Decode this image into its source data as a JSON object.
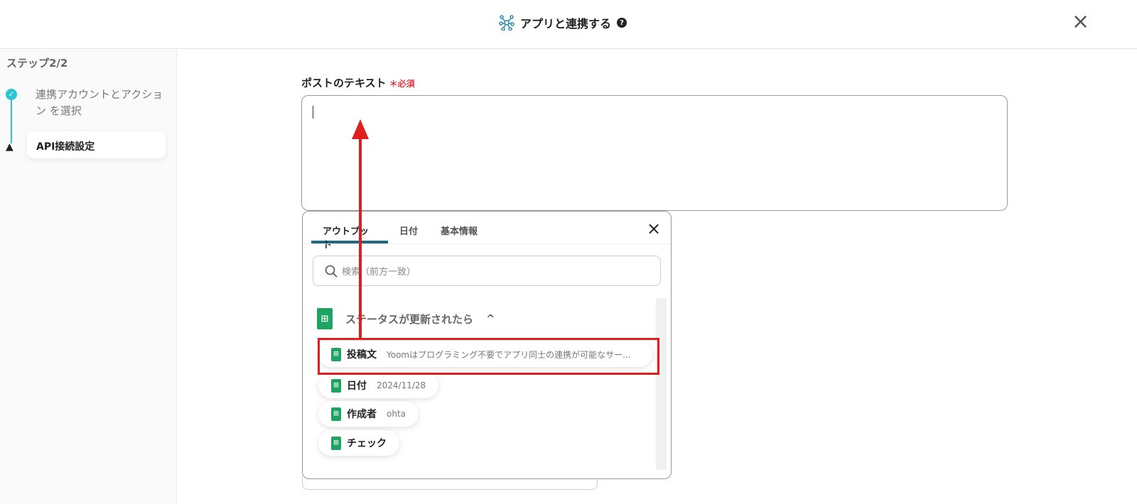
{
  "header": {
    "title": "アプリと連携する",
    "help_icon": "?",
    "close": "×"
  },
  "sidebar": {
    "step_header": "ステップ2/2",
    "steps": [
      {
        "label": "連携アカウントとアクション を選択",
        "status": "done"
      },
      {
        "label": "API接続設定",
        "status": "warning"
      }
    ]
  },
  "field": {
    "label": "ポストのテキスト",
    "required": "＊必須",
    "value": ""
  },
  "panel": {
    "tabs": [
      "アウトプット",
      "日付",
      "基本情報"
    ],
    "close": "×",
    "search_placeholder": "検索（前方一致）",
    "section": "ステータスが更新されたら",
    "chevron": "^",
    "items": [
      {
        "name": "投稿文",
        "value": "Yoomはプログラミング不要でアプリ同士の連携が可能なサー..."
      },
      {
        "name": "日付",
        "value": "2024/11/28"
      },
      {
        "name": "作成者",
        "value": "ohta"
      },
      {
        "name": "チェック",
        "value": ""
      }
    ]
  },
  "colors": {
    "accent": "#2bc4d4",
    "annotation": "#e01e1e",
    "sheets": "#1ea362"
  }
}
